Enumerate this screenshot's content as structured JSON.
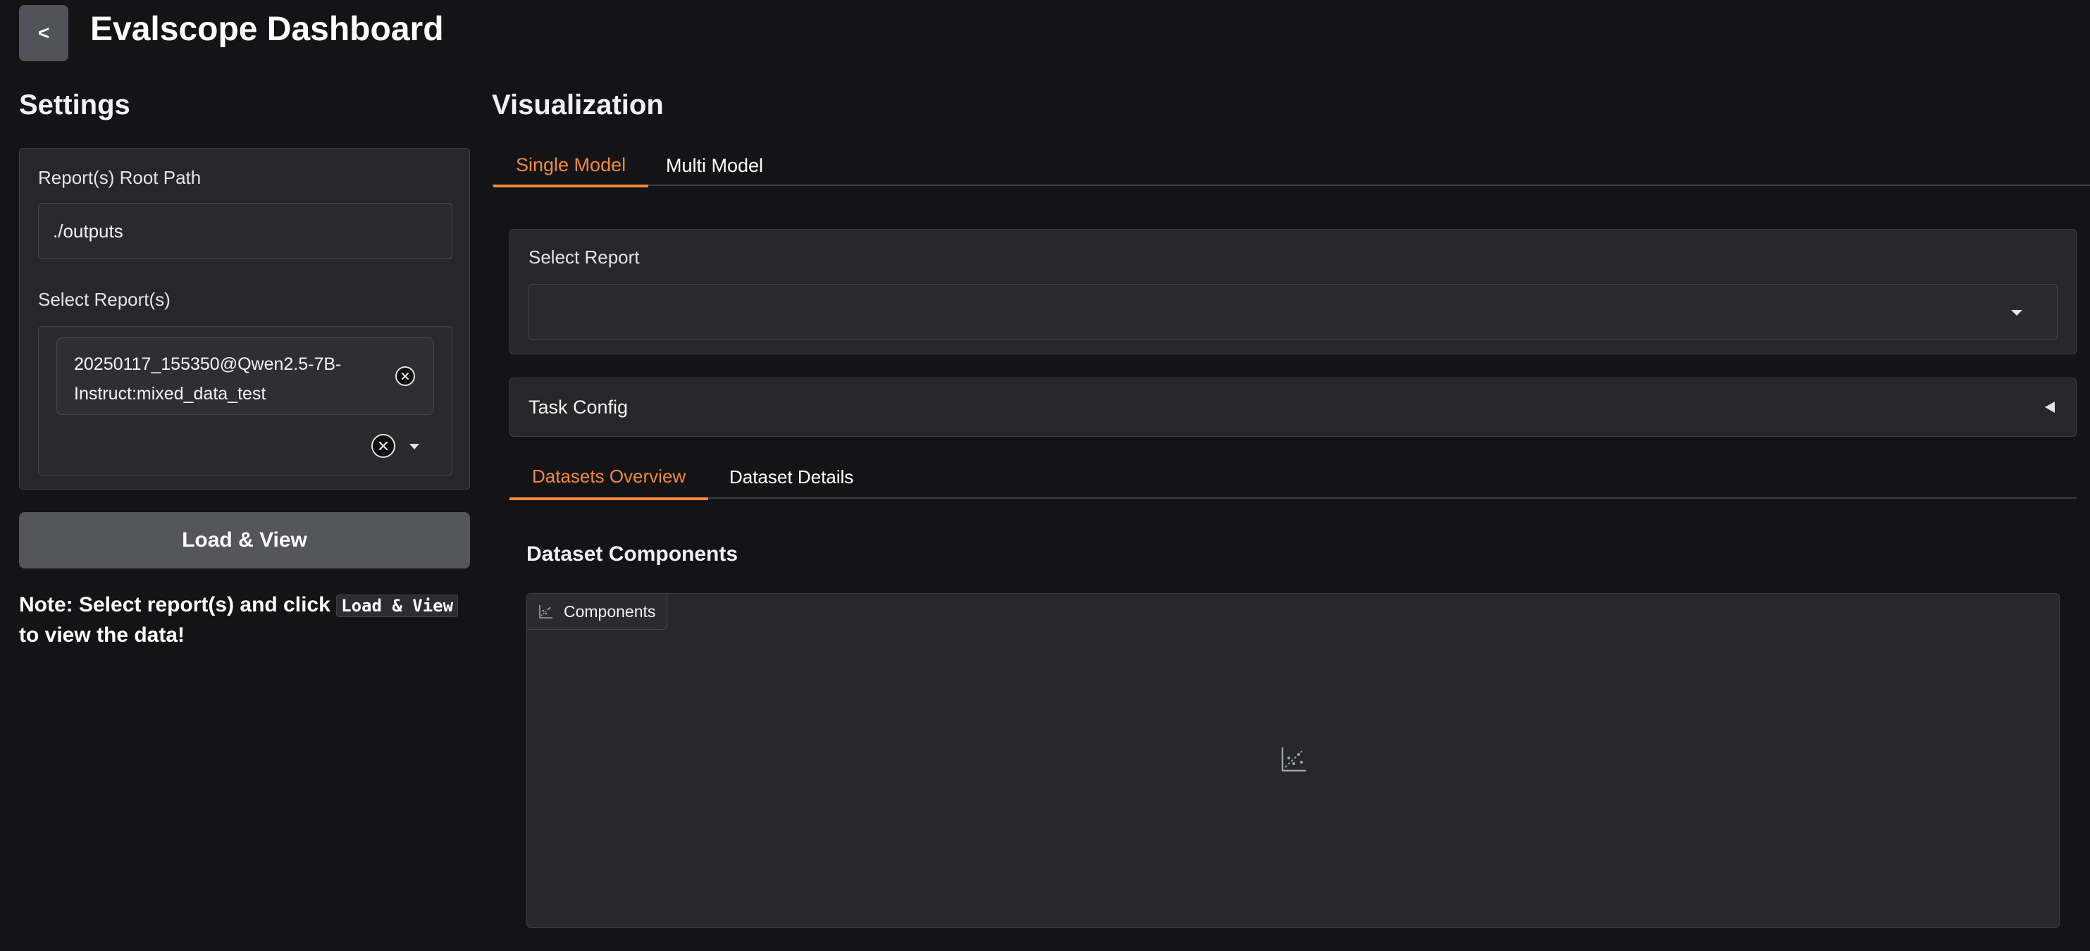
{
  "header": {
    "back_label": "<",
    "title": "Evalscope Dashboard"
  },
  "settings": {
    "title": "Settings",
    "root_path_label": "Report(s) Root Path",
    "root_path_value": "./outputs",
    "select_reports_label": "Select Report(s)",
    "selected_reports": [
      {
        "line1": "20250117_155350@Qwen2.5-7B-",
        "line2": "Instruct:mixed_data_test"
      }
    ],
    "load_button": "Load & View",
    "note_prefix": "Note: Select report(s) and click",
    "note_code": "Load & View",
    "note_suffix": "to view the data!"
  },
  "visualization": {
    "title": "Visualization",
    "tabs": [
      {
        "label": "Single Model",
        "active": true
      },
      {
        "label": "Multi Model",
        "active": false
      }
    ],
    "select_report_label": "Select Report",
    "select_report_value": "",
    "task_config_label": "Task Config",
    "subtabs": [
      {
        "label": "Datasets Overview",
        "active": true
      },
      {
        "label": "Dataset Details",
        "active": false
      }
    ],
    "components_title": "Dataset Components",
    "plot_label": "Components",
    "plot_icon": "scatter-plot-icon"
  },
  "colors": {
    "background": "#141416",
    "panel": "#27272a",
    "accent": "#f0883e",
    "button": "#55555c"
  }
}
